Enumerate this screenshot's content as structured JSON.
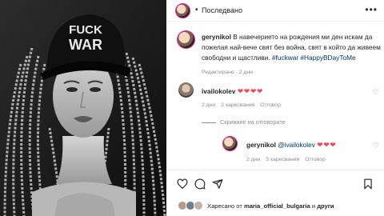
{
  "post": {
    "author": "gerynikol",
    "follow_label": "Последвано",
    "more_icon": "more-horizontal-icon"
  },
  "image": {
    "cap_text_line1": "FUCK",
    "cap_text_line2": "WAR"
  },
  "caption": {
    "username": "gerynikol",
    "text": "В навечерието на рождения ми ден искам да пожелая най-вече свят без война, свят в който да живеем свободни и щастливи.",
    "hashtags": "#fuckwar #HappyBDayToMe",
    "edited": "Редактирано · 2 дни"
  },
  "comments": [
    {
      "username": "ivailokolev",
      "text": "❤❤❤❤",
      "time": "2 дни",
      "likes": "2 харесвания",
      "reply": "Отговор"
    }
  ],
  "hide_replies": "Скриване на отговорите",
  "reply_comment": {
    "username": "gerynikol",
    "mention": "@ivailokolev",
    "text": "❤❤❤",
    "time": "2 дни",
    "likes": "3 харесвания",
    "reply": "Отговор"
  },
  "likes_row": {
    "prefix": "Харесано от",
    "user": "maria_official_bulgaria",
    "connector": "и",
    "others": "други"
  },
  "colors": {
    "link": "#00376b",
    "heart": "#ed4956",
    "meta": "#8e8e8e",
    "text": "#262626"
  }
}
